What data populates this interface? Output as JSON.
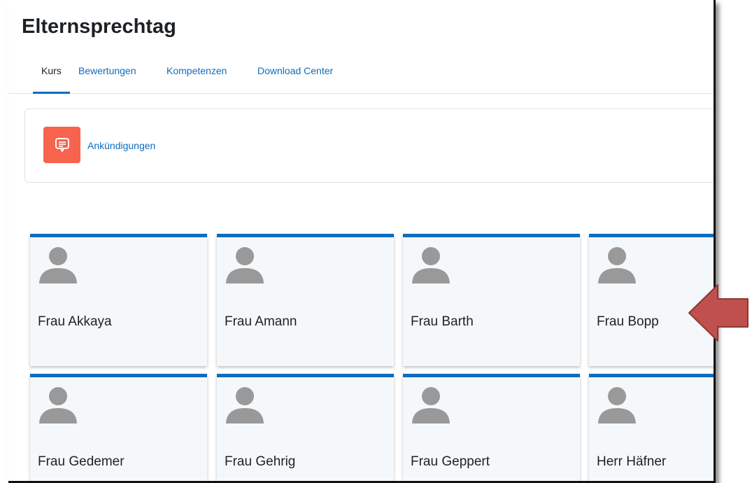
{
  "page": {
    "title": "Elternsprechtag"
  },
  "tabs": [
    {
      "label": "Kurs",
      "active": true
    },
    {
      "label": "Bewertungen",
      "active": false
    },
    {
      "label": "Kompetenzen",
      "active": false
    },
    {
      "label": "Download Center",
      "active": false
    }
  ],
  "announcements": {
    "label": "Ankündigungen",
    "icon": "forum-icon"
  },
  "teachers": [
    {
      "name": "Frau Akkaya"
    },
    {
      "name": "Frau Amann"
    },
    {
      "name": "Frau Barth"
    },
    {
      "name": "Frau Bopp"
    },
    {
      "name": "Frau Gedemer"
    },
    {
      "name": "Frau Gehrig"
    },
    {
      "name": "Frau Geppert"
    },
    {
      "name": "Herr Häfner"
    }
  ],
  "colors": {
    "accent": "#0f6cbf",
    "forum_icon_bg": "#f7634d",
    "card_bg": "#f5f8fb",
    "arrow_fill": "#c0504d",
    "avatar": "#999999"
  },
  "annotation": {
    "icon": "arrow-left-icon"
  }
}
